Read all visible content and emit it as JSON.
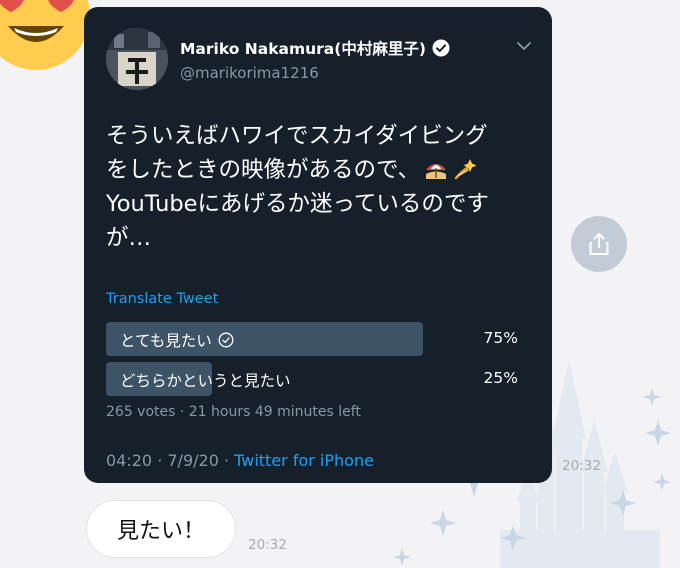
{
  "tweet": {
    "author_name": "Mariko Nakamura(中村麻里子)",
    "handle": "@marikorima1216",
    "text_lines": [
      "そういえばハワイでスカイダイビング",
      "をしたときの映像があるので、",
      "YouTubeにあげるか迷っているのです",
      "が…"
    ],
    "inline_emojis": [
      "beach-umbrella-emoji",
      "dizzy-emoji"
    ],
    "translate_label": "Translate Tweet",
    "poll": {
      "options": [
        {
          "label": "とても見たい",
          "percent_text": "75%",
          "percent": 75,
          "selected": true
        },
        {
          "label": "どちらかというと見たい",
          "percent_text": "25%",
          "percent": 25,
          "selected": false
        }
      ],
      "meta": "265 votes · 21 hours 49 minutes left"
    },
    "timestamp": "04:20 · 7/9/20 · ",
    "source": "Twitter for iPhone"
  },
  "chat": {
    "tweet_message_time": "20:32",
    "reply_text": "見たい！",
    "reply_time": "20:32"
  },
  "icons": {
    "avatar_emoji": "heart-eyes-emoji",
    "verified": "verified-badge-icon",
    "chevron": "chevron-down-icon",
    "share": "share-icon",
    "check": "check-circle-icon"
  },
  "colors": {
    "card_bg": "#15202b",
    "link": "#1da1f2",
    "muted": "#8899a6",
    "poll_bar": "#3d5466",
    "page_bg": "#f3f3f5"
  }
}
